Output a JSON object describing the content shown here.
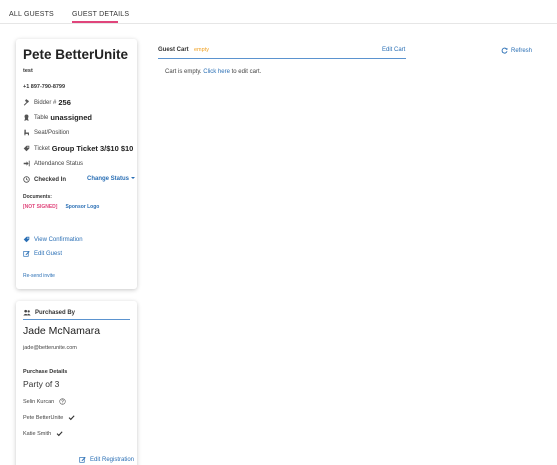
{
  "tabs": [
    {
      "label": "ALL GUESTS"
    },
    {
      "label": "GUEST DETAILS"
    }
  ],
  "guest": {
    "name": "Pete BetterUnite",
    "subtitle": "test",
    "phone": "+1 897-790-8799",
    "bidder_label": "Bidder #",
    "bidder_number": "256",
    "table_label": "Table",
    "table_value": "unassigned",
    "seat_label": "Seat/Position",
    "ticket_label": "Ticket",
    "ticket_value": "Group Ticket 3/$10 $10",
    "attendance_label": "Attendance Status",
    "checked_in_label": "Checked In",
    "change_status_label": "Change Status",
    "documents_label": "Documents:",
    "not_signed_label": "[NOT SIGNED]",
    "sponsor_logo_label": "Sponsor Logo",
    "view_confirmation_label": "View Confirmation",
    "edit_guest_label": "Edit Guest",
    "resend_invite_label": "Re-send invite"
  },
  "purchased_by": {
    "header": "Purchased By",
    "name": "Jade McNamara",
    "email": "jade@betterunite.com",
    "details_label": "Purchase Details",
    "party_label": "Party of 3",
    "members": [
      {
        "name": "Selin Kurcan",
        "icon": "help-circle-icon"
      },
      {
        "name": "Pete BetterUnite",
        "icon": "check-icon"
      },
      {
        "name": "Katie Smith",
        "icon": "check-icon"
      }
    ],
    "edit_registration_label": "Edit Registration"
  },
  "cart": {
    "title": "Guest Cart",
    "status_tag": "empty",
    "edit_label": "Edit Cart",
    "refresh_label": "Refresh",
    "empty_prefix": "Cart is empty.",
    "click_here": "Click here",
    "empty_suffix": "to edit cart."
  },
  "colors": {
    "accent_pink": "#e0457b",
    "link_blue": "#2a6fb5",
    "warning_orange": "#f0a020"
  }
}
